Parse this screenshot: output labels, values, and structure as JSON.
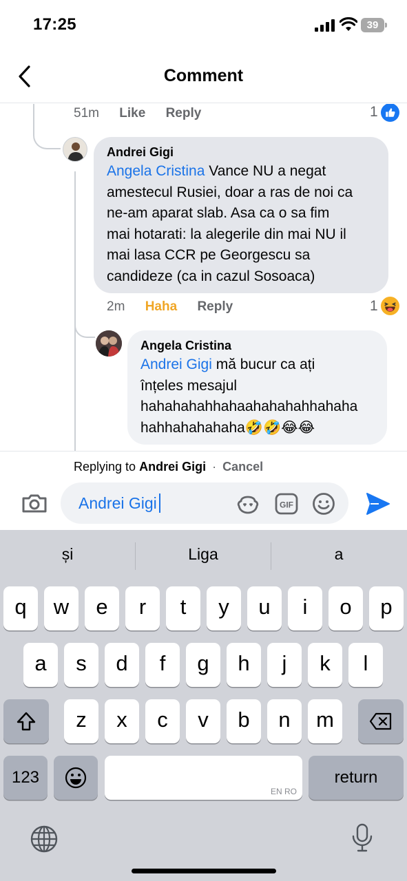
{
  "status_bar": {
    "time": "17:25",
    "battery": "39"
  },
  "header": {
    "title": "Comment"
  },
  "comments": {
    "top_meta": {
      "time": "51m",
      "like": "Like",
      "reply": "Reply",
      "reaction_count": "1",
      "reaction_icon": "like-icon"
    },
    "andrei": {
      "author": "Andrei Gigi",
      "mention": "Angela Cristina",
      "lines": [
        " Vance NU a negat",
        "amestecul Rusiei, doar a ras de noi ca",
        "ne-am aparat slab. Asa ca o sa fim",
        "mai hotarati: la alegerile din mai NU il",
        "mai lasa CCR pe Georgescu sa",
        "candideze (ca in cazul Sosoaca)"
      ],
      "time": "2m",
      "reaction_label": "Haha",
      "reply": "Reply",
      "reaction_count": "1",
      "reaction_icon": "haha-icon",
      "reaction_color": "#f0a626"
    },
    "angela": {
      "author": "Angela Cristina",
      "mention": "Andrei Gigi",
      "lines": [
        " mă bucur ca ați",
        "înțeles mesajul",
        "hahahahahhahaahahahahhahaha",
        "hahhahahahaha🤣🤣😂😂"
      ]
    }
  },
  "reply_bar": {
    "replying_to_label": "Replying to",
    "replying_to_name": "Andrei Gigi",
    "separator": "·",
    "cancel": "Cancel",
    "input_value": "Andrei Gigi"
  },
  "keyboard": {
    "suggestions": [
      "și",
      "Liga",
      "a"
    ],
    "row1": [
      "q",
      "w",
      "e",
      "r",
      "t",
      "y",
      "u",
      "i",
      "o",
      "p"
    ],
    "row2": [
      "a",
      "s",
      "d",
      "f",
      "g",
      "h",
      "j",
      "k",
      "l"
    ],
    "row3": [
      "z",
      "x",
      "c",
      "v",
      "b",
      "n",
      "m"
    ],
    "numbers_label": "123",
    "return_label": "return",
    "space_hint": "EN RO"
  },
  "colors": {
    "accent": "#1a73e8",
    "send": "#1877f2",
    "haha": "#f0a626"
  }
}
